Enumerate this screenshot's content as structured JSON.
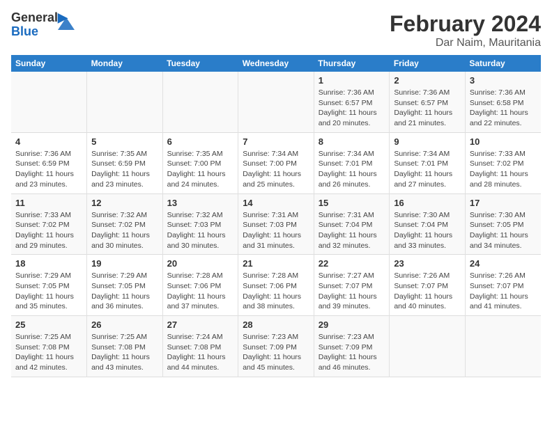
{
  "logo": {
    "line1": "General",
    "line2": "Blue"
  },
  "title": "February 2024",
  "subtitle": "Dar Naim, Mauritania",
  "days_of_week": [
    "Sunday",
    "Monday",
    "Tuesday",
    "Wednesday",
    "Thursday",
    "Friday",
    "Saturday"
  ],
  "weeks": [
    [
      {
        "num": "",
        "info": ""
      },
      {
        "num": "",
        "info": ""
      },
      {
        "num": "",
        "info": ""
      },
      {
        "num": "",
        "info": ""
      },
      {
        "num": "1",
        "info": "Sunrise: 7:36 AM\nSunset: 6:57 PM\nDaylight: 11 hours and 20 minutes."
      },
      {
        "num": "2",
        "info": "Sunrise: 7:36 AM\nSunset: 6:57 PM\nDaylight: 11 hours and 21 minutes."
      },
      {
        "num": "3",
        "info": "Sunrise: 7:36 AM\nSunset: 6:58 PM\nDaylight: 11 hours and 22 minutes."
      }
    ],
    [
      {
        "num": "4",
        "info": "Sunrise: 7:36 AM\nSunset: 6:59 PM\nDaylight: 11 hours and 23 minutes."
      },
      {
        "num": "5",
        "info": "Sunrise: 7:35 AM\nSunset: 6:59 PM\nDaylight: 11 hours and 23 minutes."
      },
      {
        "num": "6",
        "info": "Sunrise: 7:35 AM\nSunset: 7:00 PM\nDaylight: 11 hours and 24 minutes."
      },
      {
        "num": "7",
        "info": "Sunrise: 7:34 AM\nSunset: 7:00 PM\nDaylight: 11 hours and 25 minutes."
      },
      {
        "num": "8",
        "info": "Sunrise: 7:34 AM\nSunset: 7:01 PM\nDaylight: 11 hours and 26 minutes."
      },
      {
        "num": "9",
        "info": "Sunrise: 7:34 AM\nSunset: 7:01 PM\nDaylight: 11 hours and 27 minutes."
      },
      {
        "num": "10",
        "info": "Sunrise: 7:33 AM\nSunset: 7:02 PM\nDaylight: 11 hours and 28 minutes."
      }
    ],
    [
      {
        "num": "11",
        "info": "Sunrise: 7:33 AM\nSunset: 7:02 PM\nDaylight: 11 hours and 29 minutes."
      },
      {
        "num": "12",
        "info": "Sunrise: 7:32 AM\nSunset: 7:02 PM\nDaylight: 11 hours and 30 minutes."
      },
      {
        "num": "13",
        "info": "Sunrise: 7:32 AM\nSunset: 7:03 PM\nDaylight: 11 hours and 30 minutes."
      },
      {
        "num": "14",
        "info": "Sunrise: 7:31 AM\nSunset: 7:03 PM\nDaylight: 11 hours and 31 minutes."
      },
      {
        "num": "15",
        "info": "Sunrise: 7:31 AM\nSunset: 7:04 PM\nDaylight: 11 hours and 32 minutes."
      },
      {
        "num": "16",
        "info": "Sunrise: 7:30 AM\nSunset: 7:04 PM\nDaylight: 11 hours and 33 minutes."
      },
      {
        "num": "17",
        "info": "Sunrise: 7:30 AM\nSunset: 7:05 PM\nDaylight: 11 hours and 34 minutes."
      }
    ],
    [
      {
        "num": "18",
        "info": "Sunrise: 7:29 AM\nSunset: 7:05 PM\nDaylight: 11 hours and 35 minutes."
      },
      {
        "num": "19",
        "info": "Sunrise: 7:29 AM\nSunset: 7:05 PM\nDaylight: 11 hours and 36 minutes."
      },
      {
        "num": "20",
        "info": "Sunrise: 7:28 AM\nSunset: 7:06 PM\nDaylight: 11 hours and 37 minutes."
      },
      {
        "num": "21",
        "info": "Sunrise: 7:28 AM\nSunset: 7:06 PM\nDaylight: 11 hours and 38 minutes."
      },
      {
        "num": "22",
        "info": "Sunrise: 7:27 AM\nSunset: 7:07 PM\nDaylight: 11 hours and 39 minutes."
      },
      {
        "num": "23",
        "info": "Sunrise: 7:26 AM\nSunset: 7:07 PM\nDaylight: 11 hours and 40 minutes."
      },
      {
        "num": "24",
        "info": "Sunrise: 7:26 AM\nSunset: 7:07 PM\nDaylight: 11 hours and 41 minutes."
      }
    ],
    [
      {
        "num": "25",
        "info": "Sunrise: 7:25 AM\nSunset: 7:08 PM\nDaylight: 11 hours and 42 minutes."
      },
      {
        "num": "26",
        "info": "Sunrise: 7:25 AM\nSunset: 7:08 PM\nDaylight: 11 hours and 43 minutes."
      },
      {
        "num": "27",
        "info": "Sunrise: 7:24 AM\nSunset: 7:08 PM\nDaylight: 11 hours and 44 minutes."
      },
      {
        "num": "28",
        "info": "Sunrise: 7:23 AM\nSunset: 7:09 PM\nDaylight: 11 hours and 45 minutes."
      },
      {
        "num": "29",
        "info": "Sunrise: 7:23 AM\nSunset: 7:09 PM\nDaylight: 11 hours and 46 minutes."
      },
      {
        "num": "",
        "info": ""
      },
      {
        "num": "",
        "info": ""
      }
    ]
  ]
}
